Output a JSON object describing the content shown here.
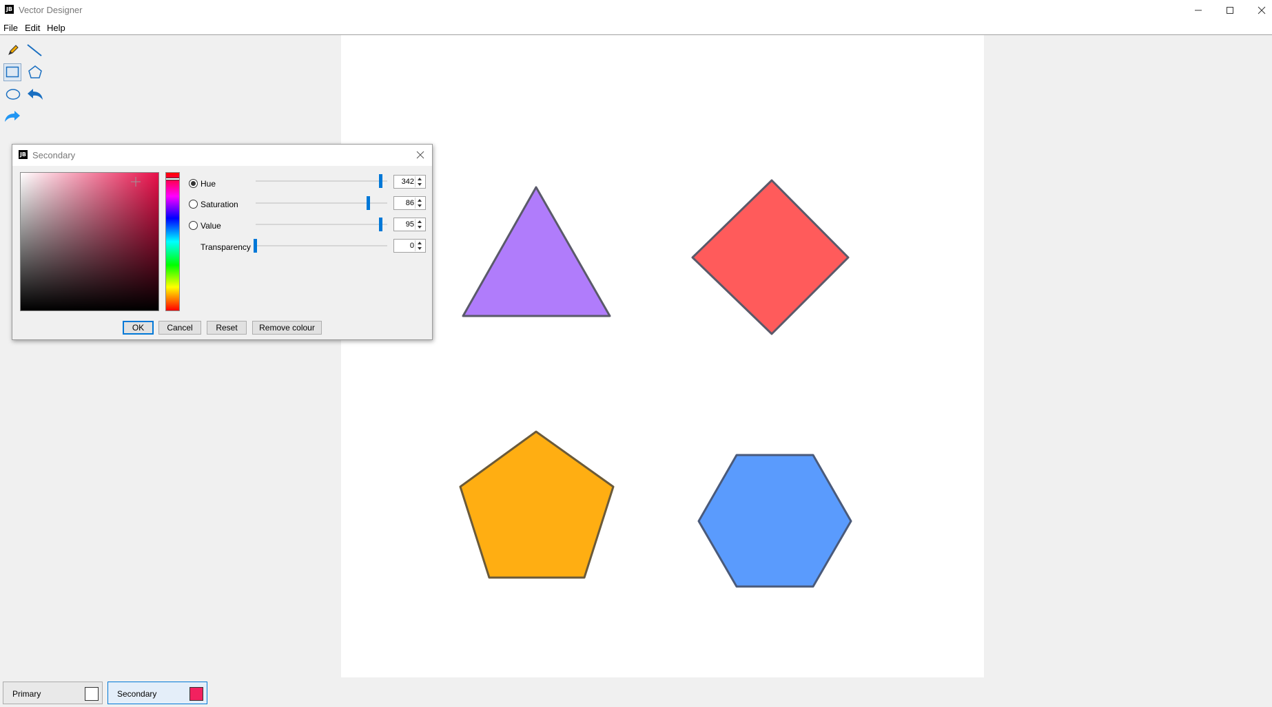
{
  "window": {
    "app_icon_text": "JB",
    "title": "Vector Designer"
  },
  "menu": {
    "file": "File",
    "edit": "Edit",
    "help": "Help"
  },
  "tools": [
    "pencil-icon",
    "line-icon",
    "rectangle-icon",
    "polygon-icon",
    "ellipse-icon",
    "undo-icon",
    "redo-icon"
  ],
  "canvas": {
    "shapes": [
      {
        "kind": "triangle",
        "fill": "#b07cfb",
        "stroke": "#5a5a6a"
      },
      {
        "kind": "diamond",
        "fill": "#ff5b5b",
        "stroke": "#5a5a6a"
      },
      {
        "kind": "pentagon",
        "fill": "#ffae12",
        "stroke": "#6a5a3a"
      },
      {
        "kind": "hexagon",
        "fill": "#5a9bfd",
        "stroke": "#4a5a7a"
      }
    ]
  },
  "dialog": {
    "icon_text": "JB",
    "title": "Secondary",
    "hue_label": "Hue",
    "saturation_label": "Saturation",
    "value_label": "Value",
    "transparency_label": "Transparency",
    "hue": "342",
    "saturation": "86",
    "value": "95",
    "transparency": "0",
    "ok": "OK",
    "cancel": "Cancel",
    "reset": "Reset",
    "remove": "Remove colour",
    "selected_color": "#f2215f"
  },
  "bottom": {
    "primary_label": "Primary",
    "primary_color": "#ffffff",
    "secondary_label": "Secondary",
    "secondary_color": "#f2215f"
  }
}
